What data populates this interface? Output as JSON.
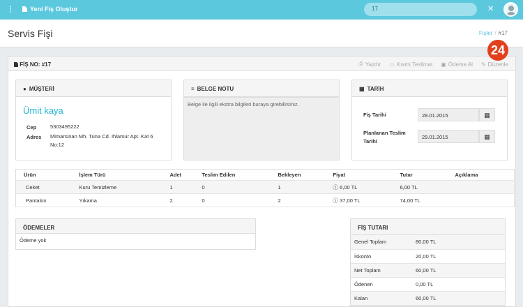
{
  "topbar": {
    "app_title": "Yeni Fiş Oluştur",
    "search_value": "17",
    "menu_icon": "ellipsis-vertical-icon",
    "tool_icon": "wrench-icon"
  },
  "page": {
    "title": "Servis Fişi",
    "breadcrumb_link": "Fişler",
    "breadcrumb_sep": "/",
    "breadcrumb_current": "#17",
    "badge": "24"
  },
  "receipt": {
    "fis_no": "FİŞ NO: #17",
    "actions": [
      "Yazdır",
      "Kısmi Teslimat",
      "Ödeme Al",
      "Düzenle"
    ]
  },
  "customer": {
    "header": "MÜŞTERİ",
    "name": "Ümit kaya",
    "phone_label": "Cep",
    "phone": "5303495222",
    "address_label": "Adres",
    "address": "Mimarsinan Mh. Tuna Cd. Ihlamur Apt. Kat 6 No:12"
  },
  "note": {
    "header": "BELGE NOTU",
    "placeholder": "Belge ile ilgili ekstra bilgileri buraya girebilirsiniz."
  },
  "dates": {
    "header": "TARİH",
    "fis_label": "Fiş Tarihi",
    "fis_value": "28.01.2015",
    "planned_label": "Planlanan Teslim Tarihi",
    "planned_value": "29.01.2015"
  },
  "items": {
    "columns": [
      "Ürün",
      "İşlem Türü",
      "Adet",
      "Teslim Edilen",
      "Bekleyen",
      "Fiyat",
      "Tutar",
      "Açıklama"
    ],
    "rows": [
      {
        "urun": "Ceket",
        "islem": "Kuru Temizleme",
        "adet": "1",
        "teslim": "0",
        "bekleyen": "1",
        "fiyat": "6,00 TL",
        "tutar": "6,00 TL",
        "aciklama": ""
      },
      {
        "urun": "Pantalon",
        "islem": "Yıkama",
        "adet": "2",
        "teslim": "0",
        "bekleyen": "2",
        "fiyat": "37,00 TL",
        "tutar": "74,00 TL",
        "aciklama": ""
      }
    ]
  },
  "payments": {
    "header": "ÖDEMELER",
    "empty": "Ödeme yok"
  },
  "totals": {
    "header": "FİŞ TUTARI",
    "rows": [
      {
        "label": "Genel Toplam",
        "value": "80,00 TL"
      },
      {
        "label": "İskonto",
        "value": "20,00 TL"
      },
      {
        "label": "Net Toplam",
        "value": "60,00 TL"
      },
      {
        "label": "Ödenen",
        "value": "0,00 TL"
      },
      {
        "label": "Kalan",
        "value": "60,00 TL"
      }
    ]
  },
  "colors": {
    "accent": "#5bc8de",
    "customer_name": "#1fb6d0",
    "badge": "#e2401c"
  }
}
